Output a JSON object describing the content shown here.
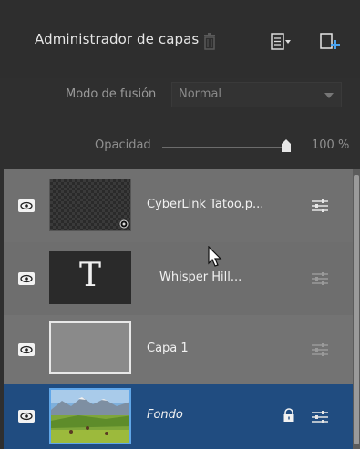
{
  "header": {
    "title": "Administrador de capas",
    "icons": [
      "trash-icon",
      "layer-menu-icon",
      "new-layer-icon"
    ]
  },
  "blend": {
    "label": "Modo de fusión",
    "value": "Normal"
  },
  "opacity": {
    "label": "Opacidad",
    "value": "100 %",
    "level": 1.0
  },
  "layers": [
    {
      "name": "CyberLink Tatoo.p...",
      "type": "image-transparent",
      "visible": true,
      "selected": false
    },
    {
      "name": "Whisper Hill...",
      "type": "text",
      "thumb_glyph": "T",
      "visible": true,
      "selected": false
    },
    {
      "name": "Capa 1",
      "type": "fill",
      "visible": true,
      "selected": false
    },
    {
      "name": "Fondo",
      "type": "photo",
      "visible": true,
      "selected": true,
      "locked": true
    }
  ],
  "colors": {
    "panel_bg": "#2f2f2f",
    "layer_bg": "#707070",
    "selected_bg": "#204c80",
    "accent": "#60a6e8"
  }
}
